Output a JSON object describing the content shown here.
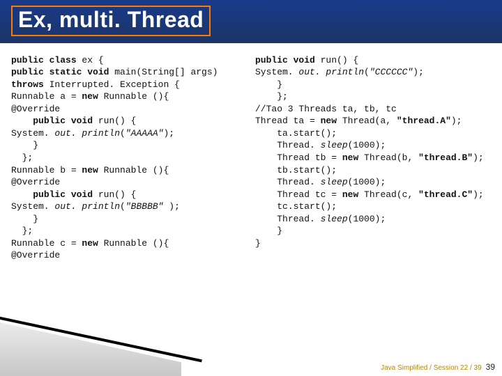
{
  "title": "Ex, multi. Thread",
  "code_left": "public class ex {\npublic static void main(String[] args) throws Interrupted. Exception {\nRunnable a = new Runnable (){\n@Override\n    public void run() {\nSystem. out. println(\"AAAAA\");\n    }\n  };\nRunnable b = new Runnable (){\n@Override\n    public void run() {\nSystem. out. println(\"BBBBB\" );\n    }\n  };\nRunnable c = new Runnable (){\n@Override",
  "code_right": "public void run() {\nSystem. out. println(\"CCCCCC\");\n    }\n    };\n//Tao 3 Threads ta, tb, tc\nThread ta = new Thread(a, \"thread.A\");\n    ta.start();\n    Thread. sleep(1000);\n    Thread tb = new Thread(b, \"thread.B\");\n    tb.start();\n    Thread. sleep(1000);\n    Thread tc = new Thread(c, \"thread.C\");\n    tc.start();\n    Thread. sleep(1000);\n    }\n}",
  "footer_text": "Java Simplified / Session 22 / 39",
  "page_number": "39"
}
